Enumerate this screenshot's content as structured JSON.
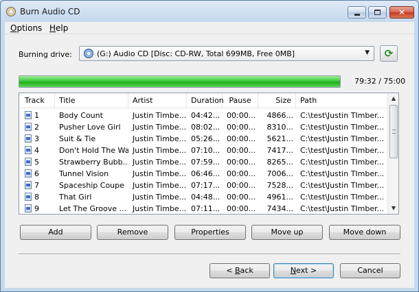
{
  "window": {
    "title": "Burn Audio CD",
    "controls": {
      "minimize": "minimize-icon",
      "maximize": "maximize-icon",
      "close": "close-icon"
    }
  },
  "menu": {
    "options": "Options",
    "help": "Help"
  },
  "drive": {
    "label": "Burning drive:",
    "selected": "(G:) Audio CD [Disc: CD-RW, Total 699MB, Free 0MB]",
    "refresh_icon": "refresh-icon"
  },
  "progress": {
    "percent": 100,
    "time": "79:32 / 75:00",
    "color": "#3fc93a"
  },
  "table": {
    "columns": [
      "Track",
      "Title",
      "Artist",
      "Duration",
      "Pause",
      "Size",
      "Path"
    ],
    "rows": [
      {
        "track": "1",
        "title": "Body Count",
        "artist": "Justin Timbe...",
        "duration": "04:42...",
        "pause": "00:00...",
        "size": "4866...",
        "path": "C:\\test\\Justin TImber..."
      },
      {
        "track": "2",
        "title": "Pusher Love Girl",
        "artist": "Justin Timbe...",
        "duration": "08:02...",
        "pause": "00:00...",
        "size": "8310...",
        "path": "C:\\test\\Justin TImber..."
      },
      {
        "track": "3",
        "title": "Suit & Tie",
        "artist": "Justin Timbe...",
        "duration": "05:26...",
        "pause": "00:00...",
        "size": "5621...",
        "path": "C:\\test\\Justin TImber..."
      },
      {
        "track": "4",
        "title": "Don't Hold The Wall",
        "artist": "Justin Timbe...",
        "duration": "07:10...",
        "pause": "00:00...",
        "size": "7417...",
        "path": "C:\\test\\Justin TImber..."
      },
      {
        "track": "5",
        "title": "Strawberry Bubb...",
        "artist": "Justin Timbe...",
        "duration": "07:59...",
        "pause": "00:00...",
        "size": "8265...",
        "path": "C:\\test\\Justin TImber..."
      },
      {
        "track": "6",
        "title": "Tunnel Vision",
        "artist": "Justin Timbe...",
        "duration": "06:46...",
        "pause": "00:00...",
        "size": "7006...",
        "path": "C:\\test\\Justin TImber..."
      },
      {
        "track": "7",
        "title": "Spaceship Coupe",
        "artist": "Justin Timbe...",
        "duration": "07:17...",
        "pause": "00:00...",
        "size": "7528...",
        "path": "C:\\test\\Justin TImber..."
      },
      {
        "track": "8",
        "title": "That Girl",
        "artist": "Justin Timbe...",
        "duration": "04:48...",
        "pause": "00:00...",
        "size": "4961...",
        "path": "C:\\test\\Justin TImber..."
      },
      {
        "track": "9",
        "title": "Let The Groove ...",
        "artist": "Justin Timbe...",
        "duration": "07:11...",
        "pause": "00:00...",
        "size": "7434...",
        "path": "C:\\test\\Justin TImber..."
      }
    ]
  },
  "actions": {
    "add": "Add",
    "remove": "Remove",
    "properties": "Properties",
    "move_up": "Move up",
    "move_down": "Move down"
  },
  "nav": {
    "back": "< Back",
    "next": "Next >",
    "cancel": "Cancel"
  }
}
